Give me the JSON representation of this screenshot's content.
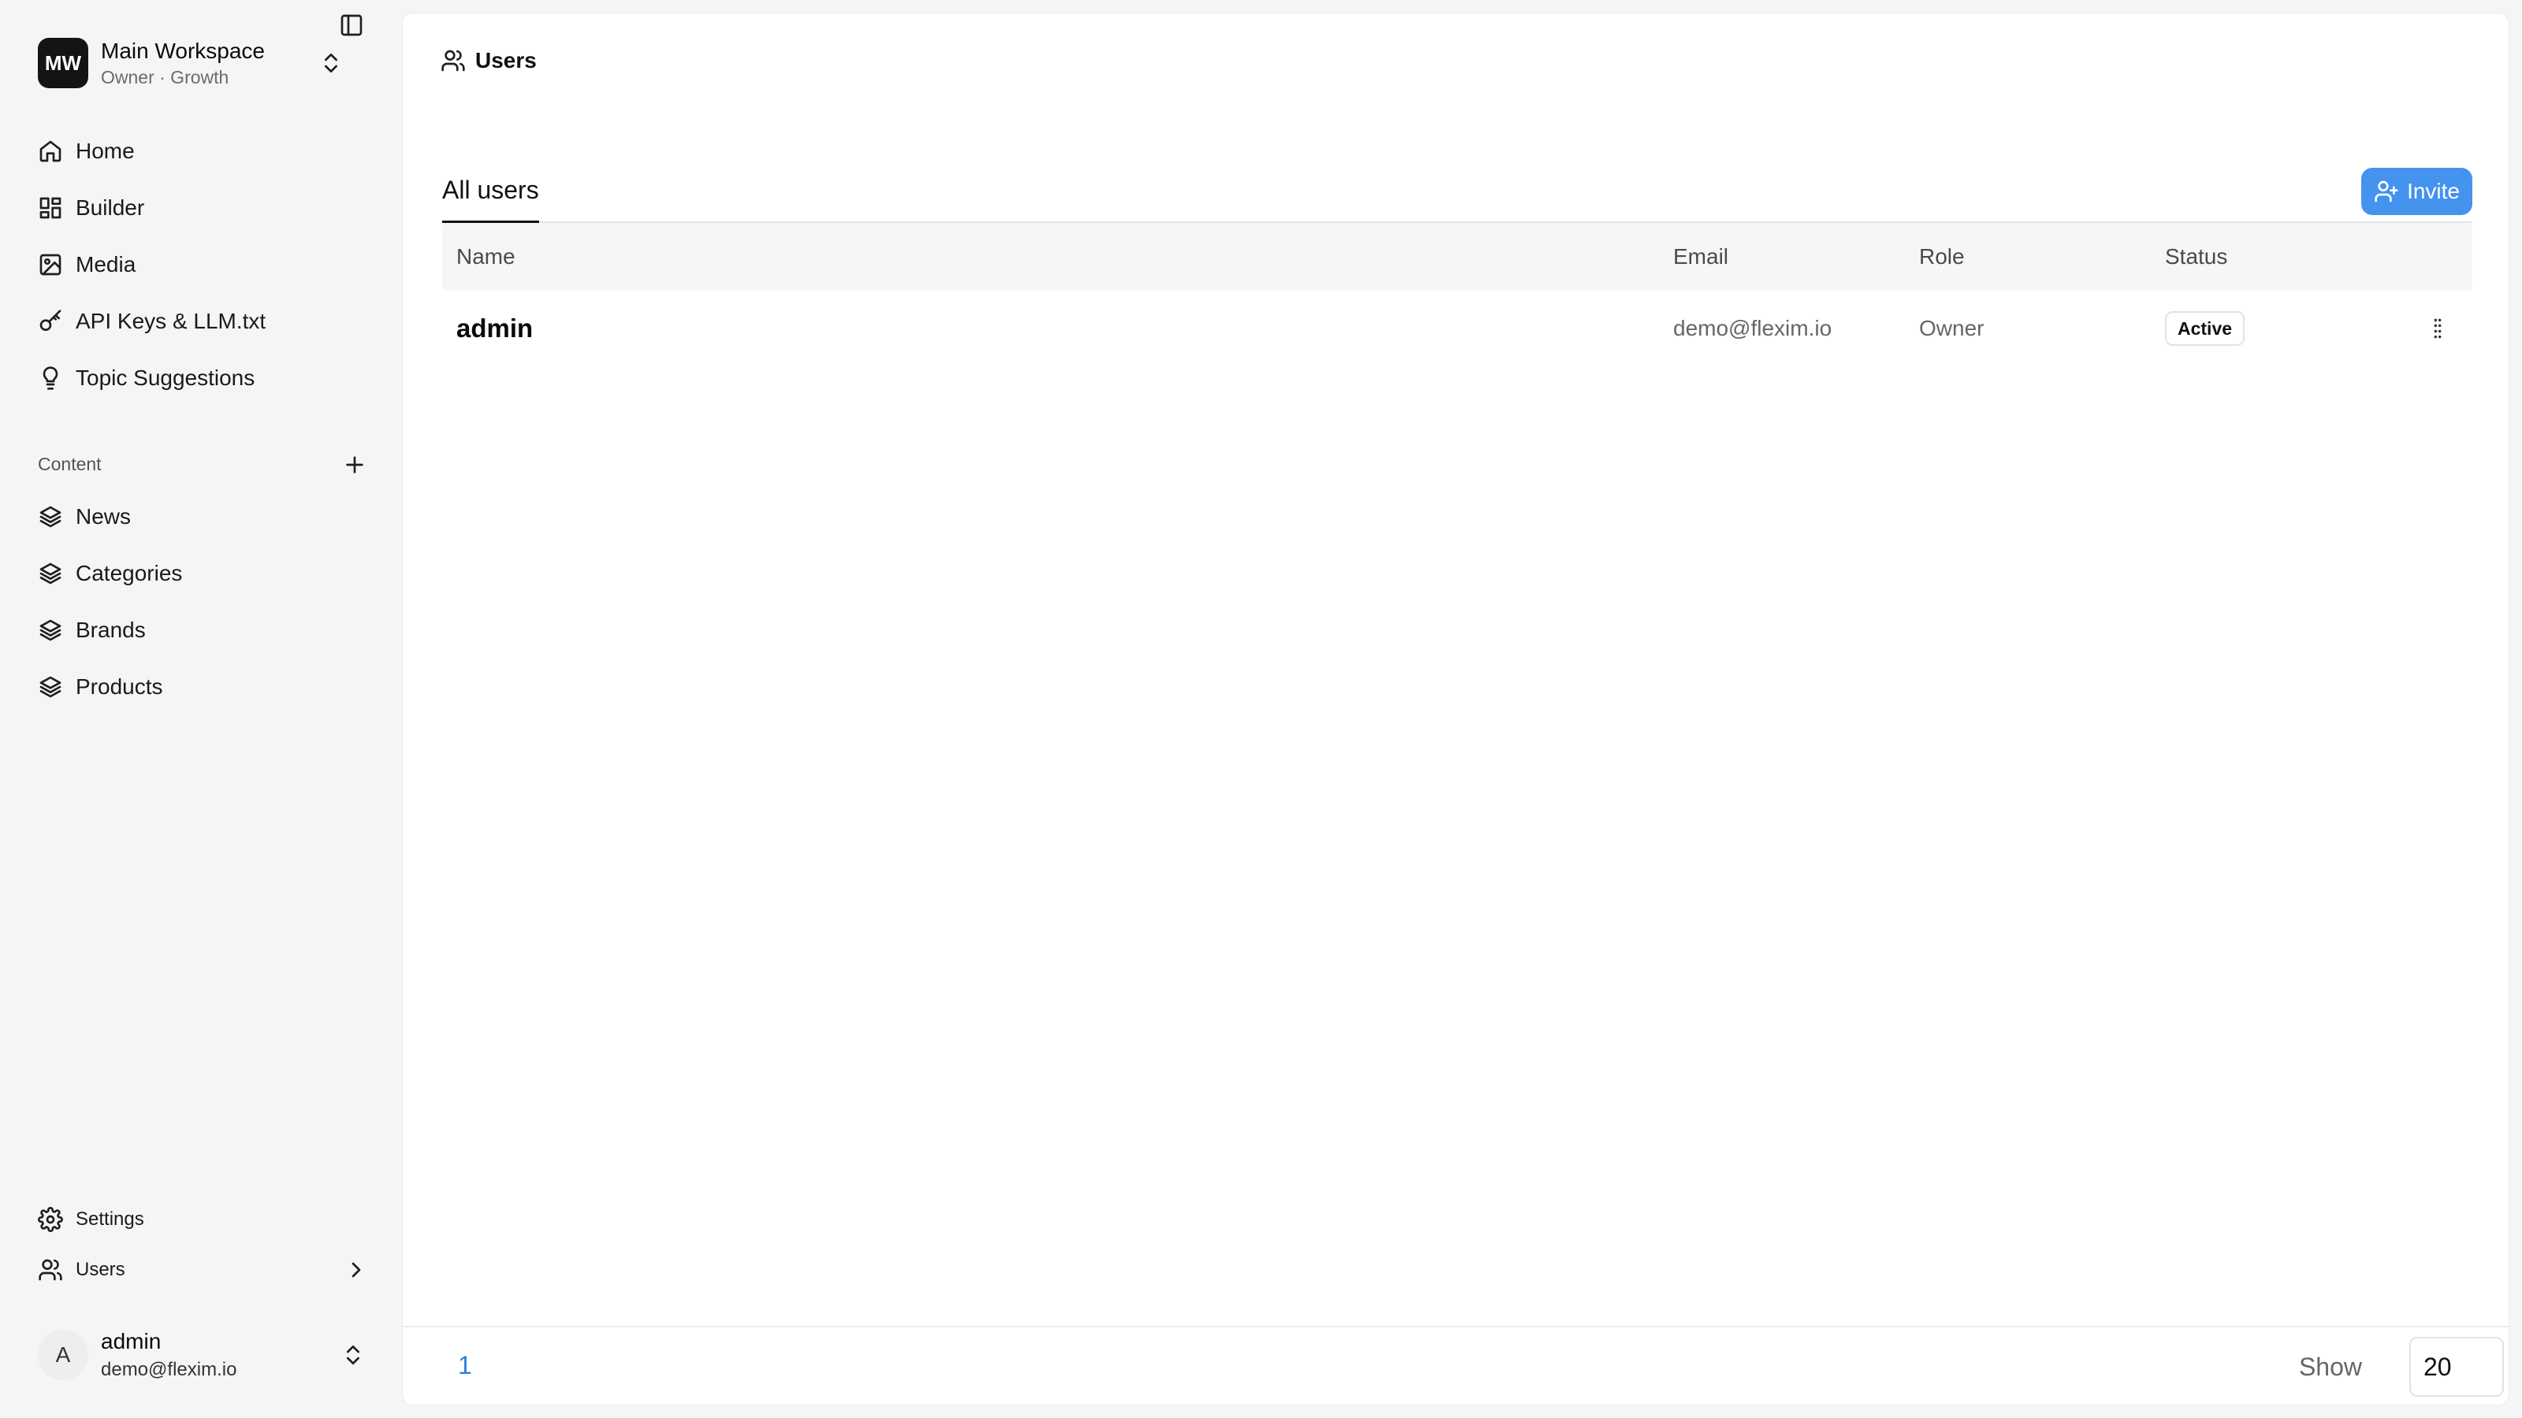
{
  "workspace": {
    "logo_text": "MW",
    "name": "Main Workspace",
    "subtitle": "Owner · Growth"
  },
  "nav": {
    "items": [
      {
        "label": "Home",
        "icon": "home-icon"
      },
      {
        "label": "Builder",
        "icon": "grid-icon"
      },
      {
        "label": "Media",
        "icon": "image-icon"
      },
      {
        "label": "API Keys & LLM.txt",
        "icon": "key-icon"
      },
      {
        "label": "Topic Suggestions",
        "icon": "lightbulb-icon"
      }
    ]
  },
  "content": {
    "section_label": "Content",
    "items": [
      {
        "label": "News",
        "icon": "layers-icon"
      },
      {
        "label": "Categories",
        "icon": "layers-icon"
      },
      {
        "label": "Brands",
        "icon": "layers-icon"
      },
      {
        "label": "Products",
        "icon": "layers-icon"
      }
    ]
  },
  "bottom_nav": {
    "settings_label": "Settings",
    "users_label": "Users"
  },
  "account": {
    "avatar_letter": "A",
    "name": "admin",
    "email": "demo@flexim.io"
  },
  "page": {
    "breadcrumb": "Users",
    "tab_label": "All users",
    "invite_label": "Invite"
  },
  "table": {
    "columns": [
      "Name",
      "Email",
      "Role",
      "Status"
    ],
    "rows": [
      {
        "name": "admin",
        "email": "demo@flexim.io",
        "role": "Owner",
        "status": "Active"
      }
    ]
  },
  "pagination": {
    "current_page": "1",
    "show_label": "Show",
    "page_size": "20"
  },
  "colors": {
    "accent": "#4493ee",
    "link": "#2f7fe0"
  }
}
